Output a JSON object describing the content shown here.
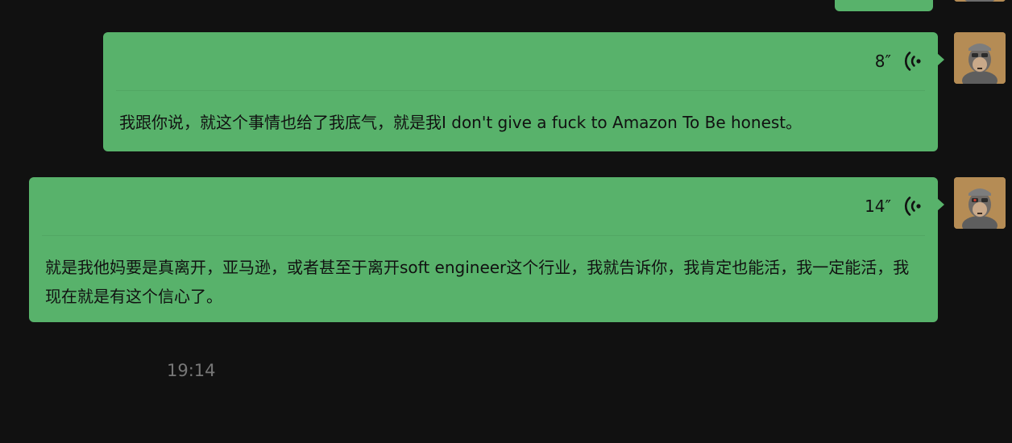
{
  "messages": [
    {
      "duration": "8″",
      "transcript": "我跟你说，就这个事情也给了我底气，就是我I don't give a fuck to Amazon To Be honest。"
    },
    {
      "duration": "14″",
      "transcript": "就是我他妈要是真离开，亚马逊，或者甚至于离开soft engineer这个行业，我就告诉你，我肯定也能活，我一定能活，我现在就是有这个信心了。"
    }
  ],
  "timestamp": "19:14",
  "colors": {
    "background": "#111111",
    "bubble": "#58b26b",
    "timestamp": "#777777"
  },
  "icons": {
    "voice": "voice-wave-icon",
    "avatar": "ape-avatar"
  }
}
